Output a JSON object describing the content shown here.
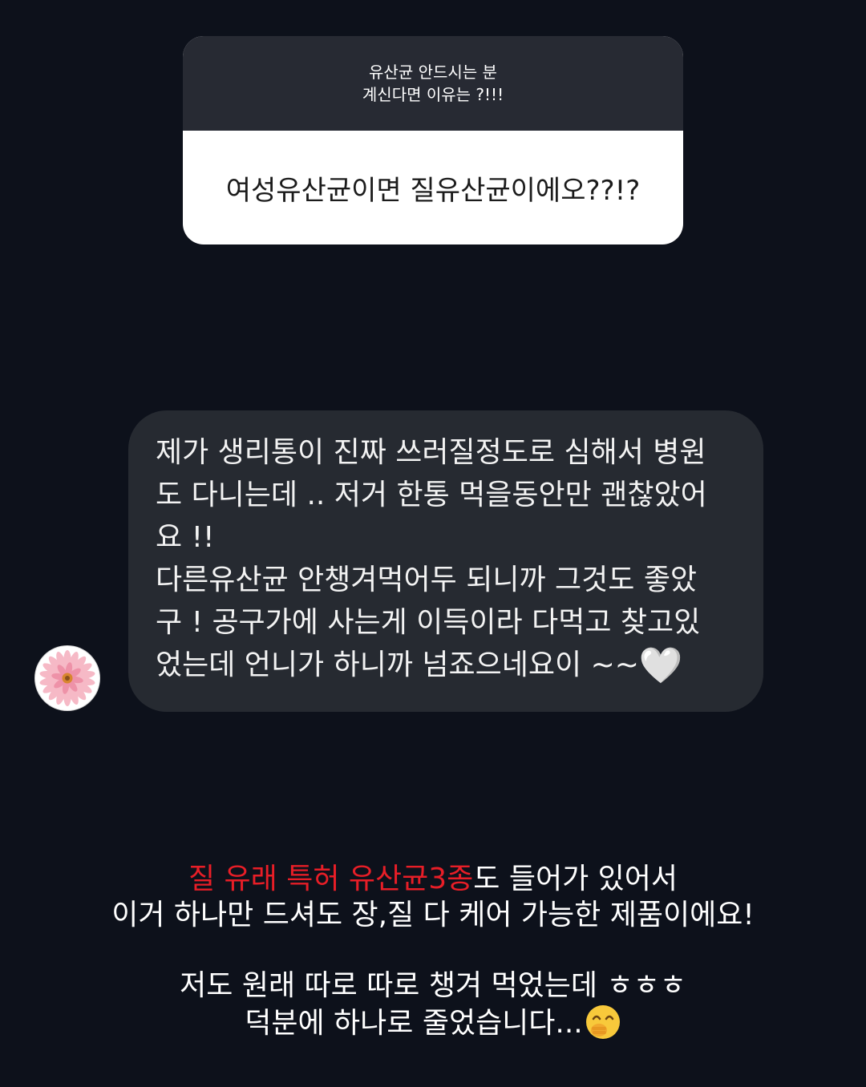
{
  "question": {
    "line1": "유산균 안드시는 분",
    "line2": "계신다면 이유는 ?!!!",
    "answer": "여성유산균이면 질유산균이에오??!?"
  },
  "reply": {
    "avatar_icon": "pink-flower-icon",
    "lines": [
      "제가 생리통이 진짜 쓰러질정도로 심해서 병원",
      "도 다니는데 .. 저거 한통 먹을동안만 괜찮았어",
      "요 !!",
      "다른유산균 안챙겨먹어두 되니까 그것도 좋았",
      "구 ! 공구가에 사는게 이득이라 다먹고 찾고있",
      "었는데 언니가 하니까 넘죠으네요이 ~~"
    ],
    "heart": "🤍",
    "heart_icon": "white-heart-icon"
  },
  "caption": {
    "highlight": "질 유래 특허 유산균3종",
    "line1_rest": "도 들어가 있어서",
    "line2": "이거 하나만 드셔도 장,질 다 케어 가능한 제품이에요!",
    "line3": "저도 원래 따로 따로 챙겨 먹었는데 ㅎㅎㅎ",
    "line4": "덕분에 하나로 줄었습니다...",
    "emoji_icon": "hand-over-mouth-emoji-icon"
  },
  "colors": {
    "background": "#0d111b",
    "highlight": "#e81e27",
    "bubble": "#262a31",
    "card_header": "#272a33"
  }
}
